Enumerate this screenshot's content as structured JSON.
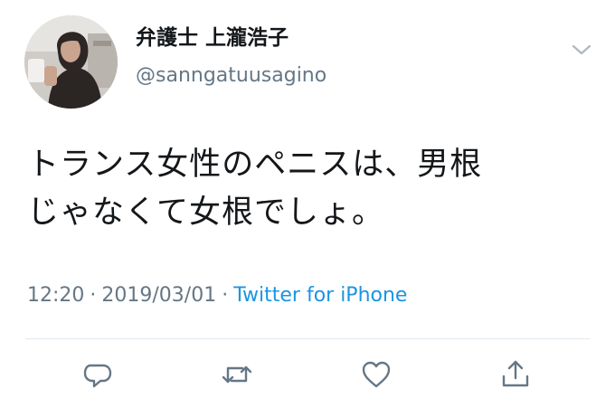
{
  "author": {
    "display_name": "弁護士 上瀧浩子",
    "handle": "@sanngatuusagino"
  },
  "tweet": {
    "lines": [
      "トランス女性のペニスは、男根",
      "じゃなくて女根でしょ。"
    ]
  },
  "meta": {
    "time": "12:20",
    "separator": "·",
    "date": "2019/03/01",
    "source": "Twitter for iPhone"
  },
  "actions": [
    {
      "icon": "reply-icon"
    },
    {
      "icon": "retweet-icon"
    },
    {
      "icon": "like-icon"
    },
    {
      "icon": "share-icon"
    }
  ],
  "colors": {
    "text": "#14171a",
    "secondary": "#657786",
    "link": "#1b95e0",
    "divider": "#e1e8ed"
  }
}
